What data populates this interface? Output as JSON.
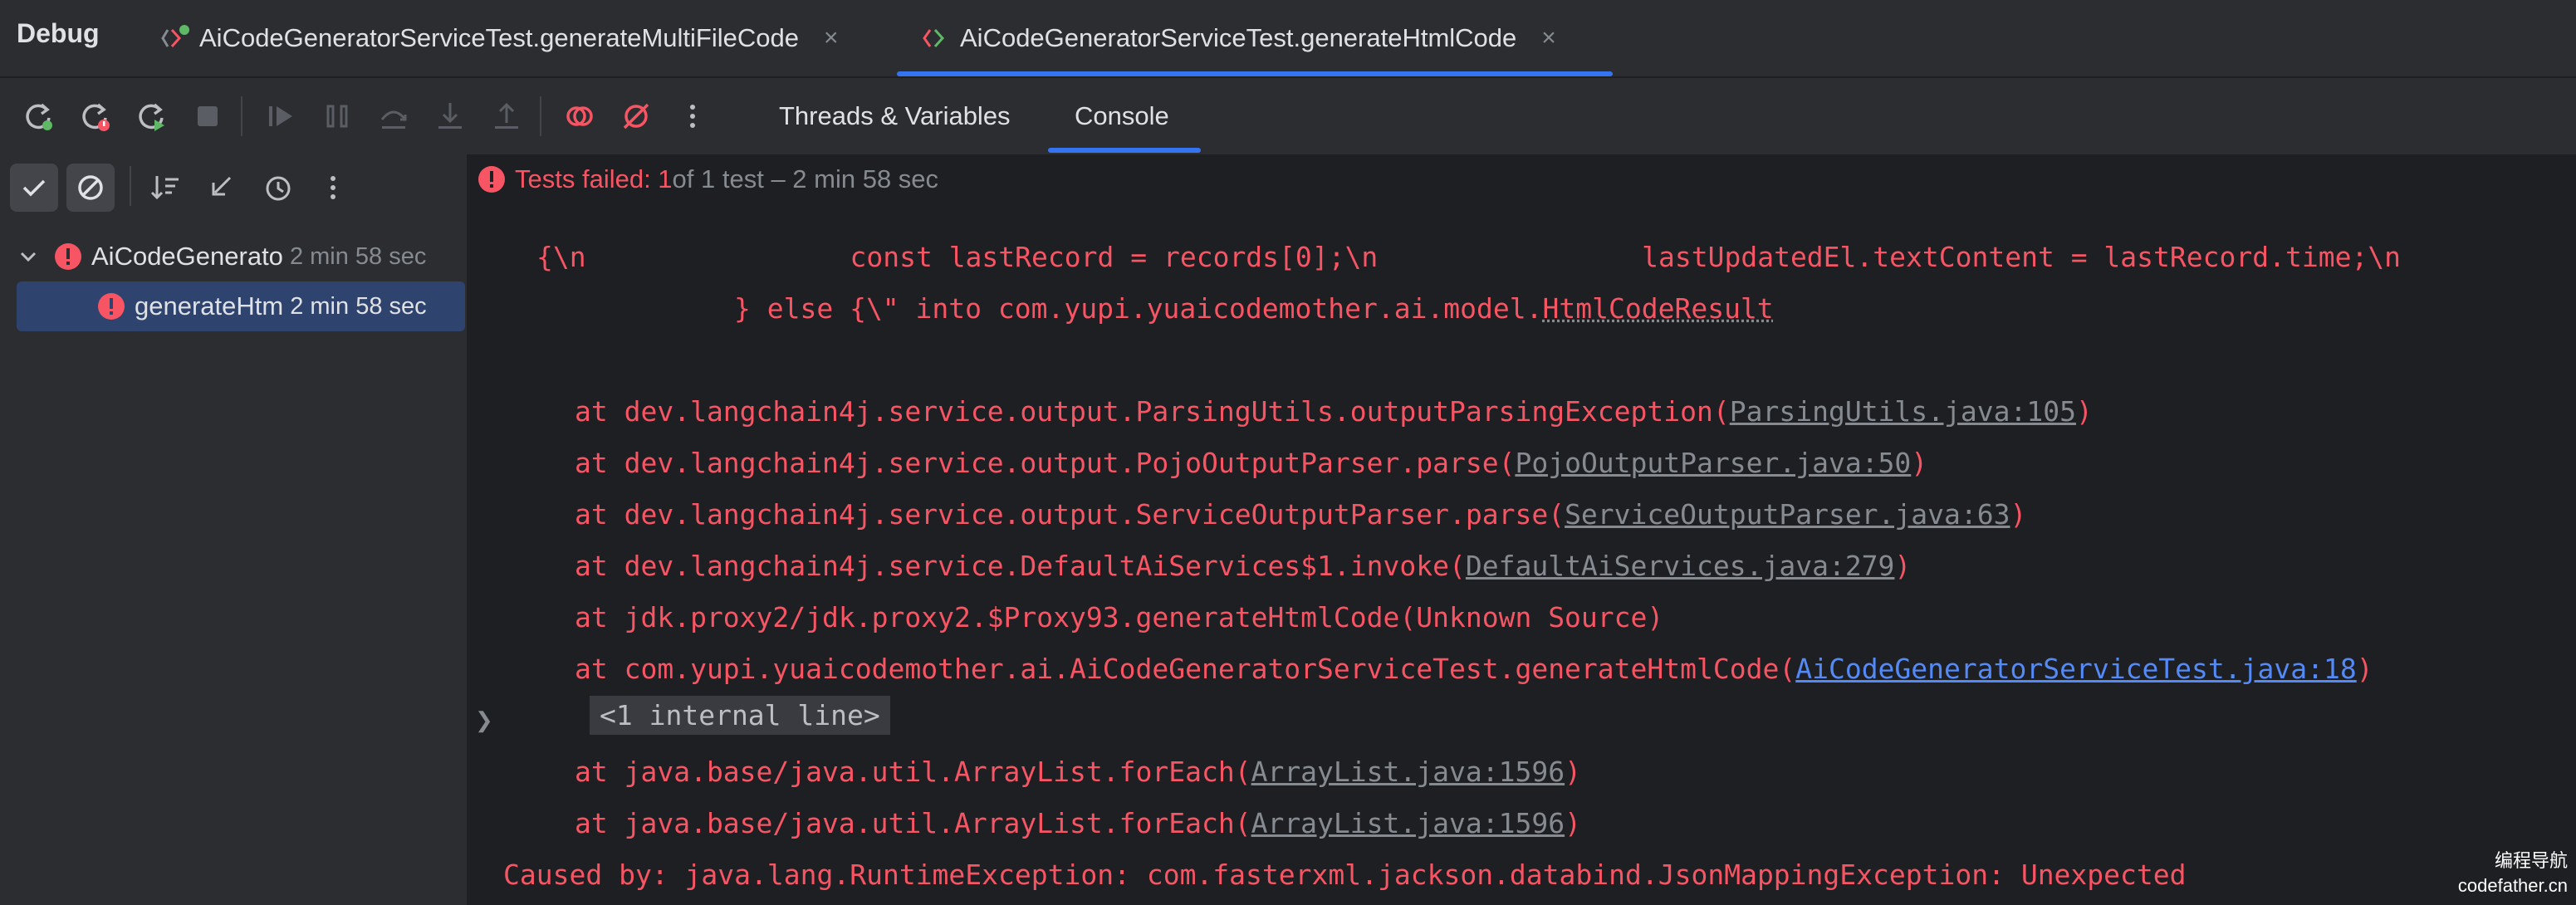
{
  "window": {
    "title": "Debug"
  },
  "run_tabs": [
    {
      "label": "AiCodeGeneratorServiceTest.generateMultiFileCode",
      "close": "×",
      "active": false
    },
    {
      "label": "AiCodeGeneratorServiceTest.generateHtmlCode",
      "close": "×",
      "active": true
    }
  ],
  "toolbar": {
    "icons": [
      "rerun-icon",
      "rerun-failed-icon",
      "rerun-auto-icon",
      "stop-icon",
      "resume-icon",
      "pause-icon",
      "step-over-icon",
      "step-into-icon",
      "step-out-icon",
      "view-breakpoints-icon",
      "mute-breakpoints-icon",
      "more-icon"
    ],
    "tabs": [
      {
        "label": "Threads & Variables",
        "active": false
      },
      {
        "label": "Console",
        "active": true
      }
    ]
  },
  "tree_toolbar": {
    "icons": [
      "show-passed-icon",
      "show-ignored-icon",
      "sort-icon",
      "collapse-icon",
      "history-icon",
      "more-icon"
    ]
  },
  "status": {
    "failed_label": "Tests failed: 1",
    "rest": " of 1 test – 2 min 58 sec"
  },
  "tree": [
    {
      "name": "AiCodeGenerato",
      "duration": "2 min 58 sec",
      "status": "failed",
      "expanded": true
    },
    {
      "name": "generateHtm",
      "duration": "2 min 58 sec",
      "status": "failed",
      "selected": true
    }
  ],
  "console": {
    "line1": "{\\n                const lastRecord = records[0];\\n                lastUpdatedEl.textContent = lastRecord.time;\\n",
    "line2_prefix": "} else {\\\" into com.yupi.yuaicodemother.ai.model.",
    "line2_class": "HtmlCodeResult",
    "frames": [
      {
        "text": "at dev.langchain4j.service.output.ParsingUtils.outputParsingException(",
        "link": "ParsingUtils.java:105",
        "suffix": ")"
      },
      {
        "text": "at dev.langchain4j.service.output.PojoOutputParser.parse(",
        "link": "PojoOutputParser.java:50",
        "suffix": ")"
      },
      {
        "text": "at dev.langchain4j.service.output.ServiceOutputParser.parse(",
        "link": "ServiceOutputParser.java:63",
        "suffix": ")"
      },
      {
        "text": "at dev.langchain4j.service.DefaultAiServices$1.invoke(",
        "link": "DefaultAiServices.java:279",
        "suffix": ")"
      },
      {
        "text": "at jdk.proxy2/jdk.proxy2.$Proxy93.generateHtmlCode(Unknown Source)"
      },
      {
        "text": "at com.yupi.yuaicodemother.ai.AiCodeGeneratorServiceTest.generateHtmlCode(",
        "link": "AiCodeGeneratorServiceTest.java:18",
        "suffix": ")"
      }
    ],
    "internal_line": "<1 internal line>",
    "frames2": [
      {
        "text": "at java.base/java.util.ArrayList.forEach(",
        "link": "ArrayList.java:1596",
        "suffix": ")"
      },
      {
        "text": "at java.base/java.util.ArrayList.forEach(",
        "link": "ArrayList.java:1596",
        "suffix": ")"
      }
    ],
    "caused_by": "Caused by: java.lang.RuntimeException: com.fasterxml.jackson.databind.JsonMappingException: Unexpected"
  },
  "watermark": {
    "line1": "编程导航",
    "line2": "codefather.cn"
  },
  "colors": {
    "error": "#f75464",
    "accent": "#3574f0",
    "link": "#548af7"
  }
}
